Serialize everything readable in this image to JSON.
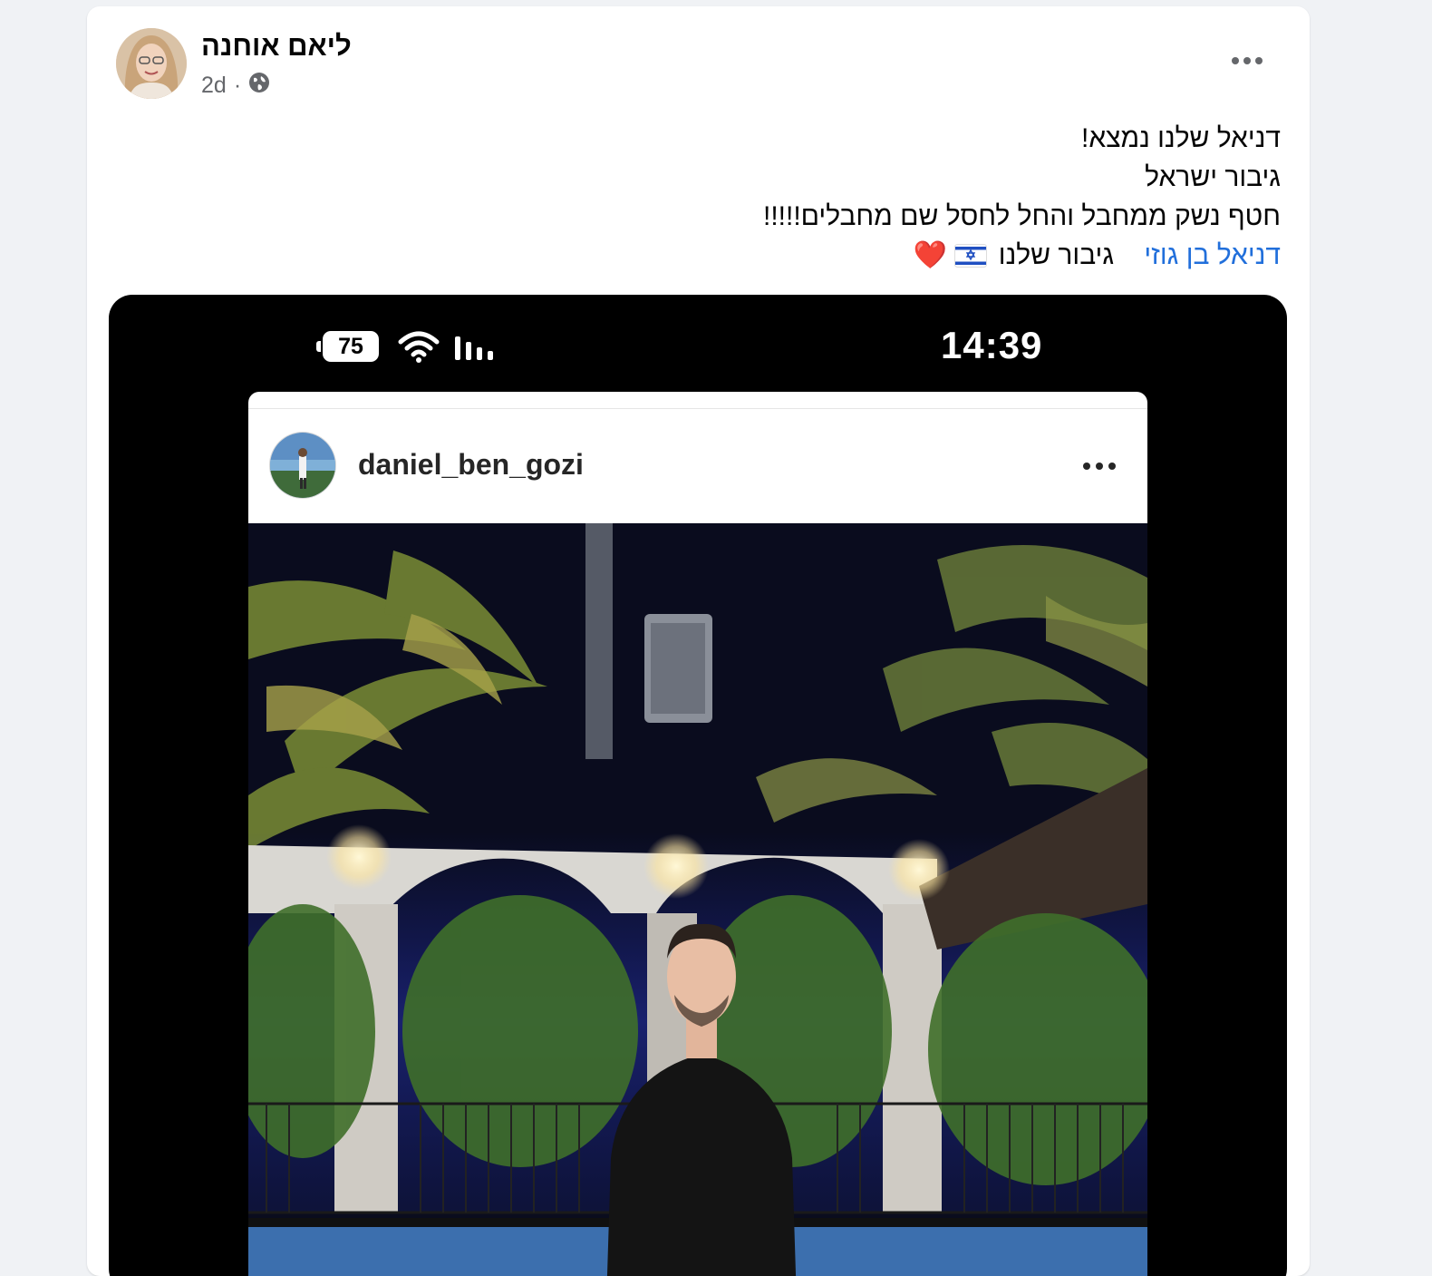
{
  "post": {
    "author": "ליאם אוחנה",
    "time": "2d",
    "separator": "·",
    "privacy_icon": "globe-icon",
    "lines": [
      "דניאל שלנו נמצא!",
      "גיבור ישראל",
      "חטף נשק ממחבל והחל לחסל שם מחבלים!!!!!"
    ],
    "mention": "דניאל בן גוזי",
    "closing": "גיבור שלנו",
    "heart": "❤️"
  },
  "phone": {
    "time": "14:39",
    "battery": "75"
  },
  "instagram": {
    "username": "daniel_ben_gozi"
  },
  "colors": {
    "link": "#216fdb",
    "page_bg": "#f0f2f5",
    "meta": "#65676b"
  }
}
